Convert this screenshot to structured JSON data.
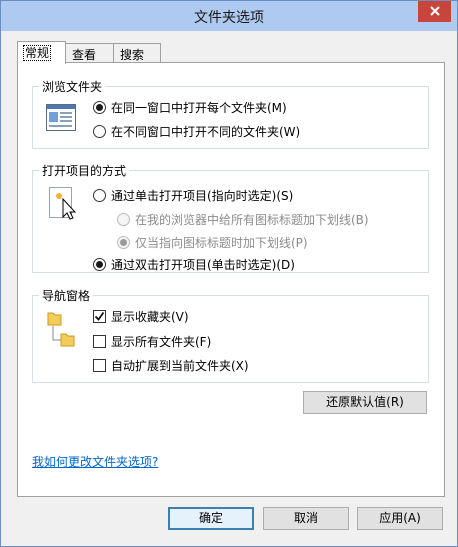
{
  "window": {
    "title": "文件夹选项"
  },
  "tabs": [
    {
      "label": "常规"
    },
    {
      "label": "查看"
    },
    {
      "label": "搜索"
    }
  ],
  "browse": {
    "title": "浏览文件夹",
    "options": [
      {
        "label": "在同一窗口中打开每个文件夹(M)",
        "checked": true
      },
      {
        "label": "在不同窗口中打开不同的文件夹(W)",
        "checked": false
      }
    ]
  },
  "open_method": {
    "title": "打开项目的方式",
    "single_click": "通过单击打开项目(指向时选定)(S)",
    "underline_browser": "在我的浏览器中给所有图标标题加下划线(B)",
    "underline_point": "仅当指向图标标题时加下划线(P)",
    "double_click": "通过双击打开项目(单击时选定)(D)"
  },
  "nav_pane": {
    "title": "导航窗格",
    "show_favorites": "显示收藏夹(V)",
    "show_all_folders": "显示所有文件夹(F)",
    "auto_expand": "自动扩展到当前文件夹(X)"
  },
  "restore_defaults": "还原默认值(R)",
  "help_link": "我如何更改文件夹选项?",
  "footer": {
    "ok": "确定",
    "cancel": "取消",
    "apply": "应用(A)"
  }
}
